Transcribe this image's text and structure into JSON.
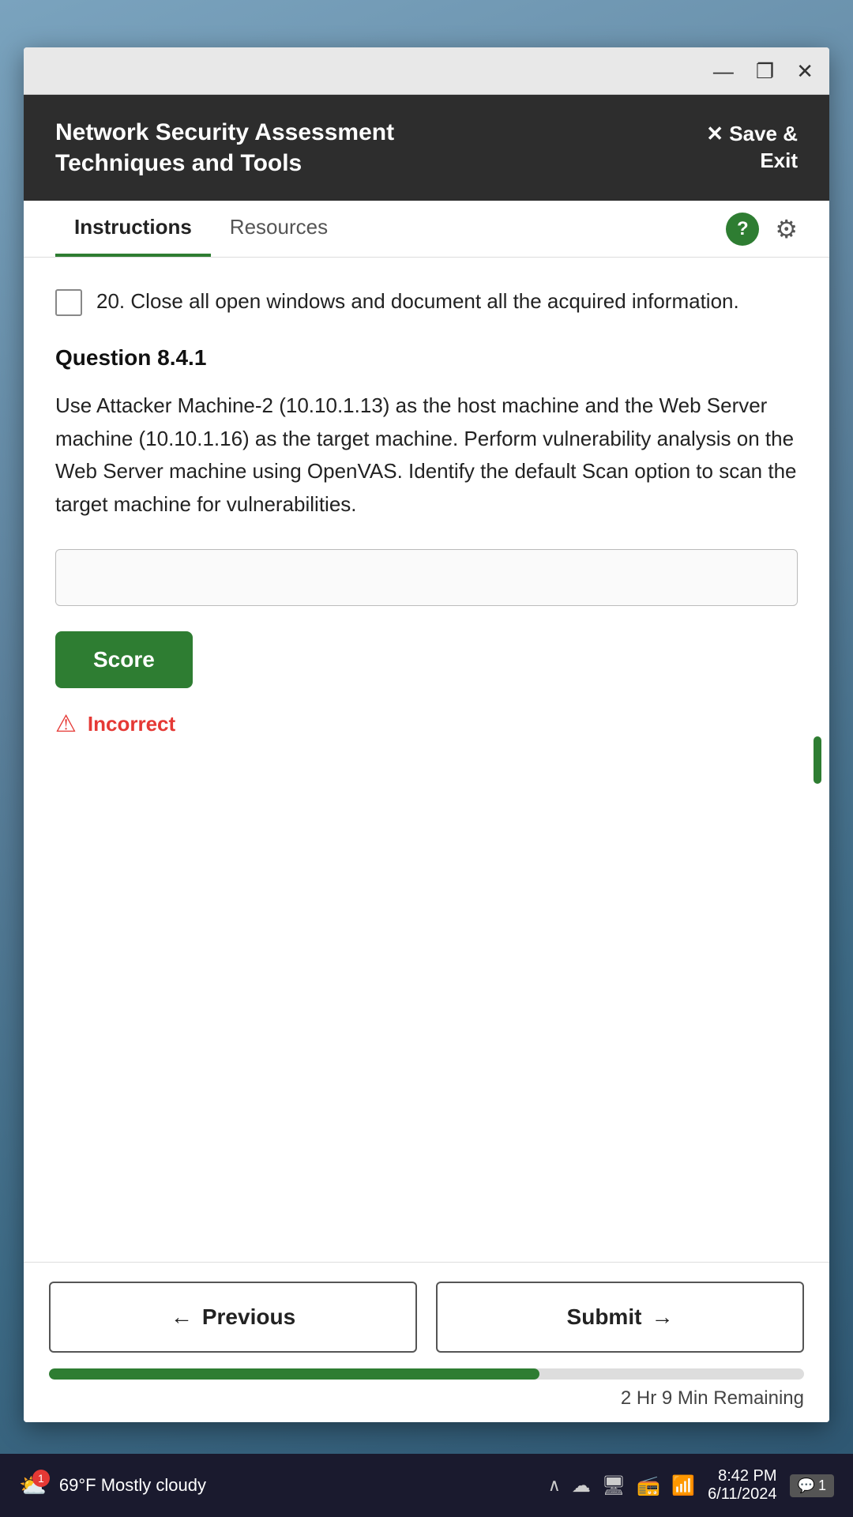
{
  "titlebar": {
    "minimize_label": "—",
    "restore_label": "❐",
    "close_label": "✕"
  },
  "header": {
    "app_title": "Network Security Assessment\nTechniques and Tools",
    "save_exit_label": "✕ Save &\nExit"
  },
  "tabs": {
    "items": [
      {
        "id": "instructions",
        "label": "Instructions",
        "active": true
      },
      {
        "id": "resources",
        "label": "Resources",
        "active": false
      }
    ],
    "help_icon": "?",
    "gear_icon": "⚙"
  },
  "content": {
    "task_number": "20.",
    "task_text": "Close all open windows and document all the acquired information.",
    "question_title": "Question 8.4.1",
    "question_body": "Use Attacker Machine-2 (10.10.1.13) as the host machine and the Web Server machine (10.10.1.16) as the target machine. Perform vulnerability analysis on the Web Server machine using OpenVAS. Identify the default Scan option to scan the target machine for vulnerabilities.",
    "answer_placeholder": "",
    "score_button_label": "Score",
    "feedback_text": "Incorrect"
  },
  "navigation": {
    "previous_label": "Previous",
    "submit_label": "Submit",
    "previous_arrow": "←",
    "submit_arrow": "→",
    "time_remaining": "2 Hr 9 Min Remaining",
    "progress_percent": 65
  },
  "taskbar": {
    "weather_temp": "69°F",
    "weather_desc": "Mostly cloudy",
    "time": "8:42 PM",
    "date": "6/11/2024",
    "badge_count": "1"
  }
}
